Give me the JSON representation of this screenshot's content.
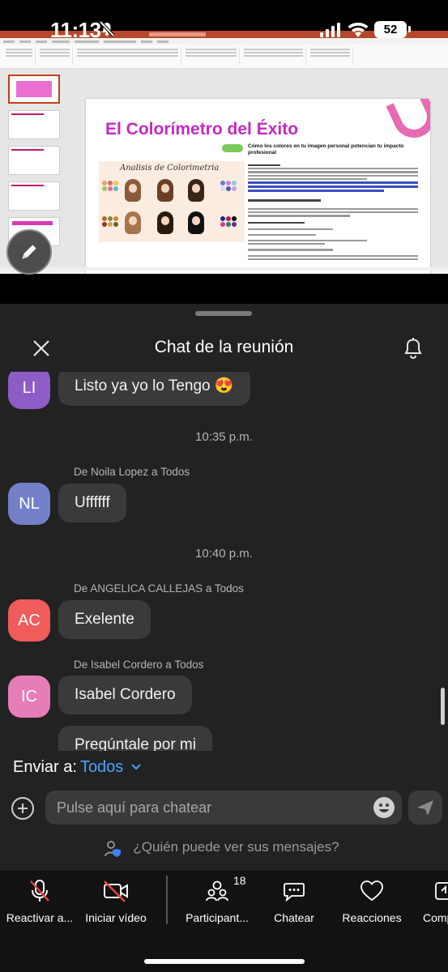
{
  "status_bar": {
    "time": "11:13",
    "battery": "52"
  },
  "shared_screen": {
    "slide_title": "El Colorímetro del Éxito",
    "slide_subtitle": "Cómo los colores en tu imagen personal potencian tu impacto profesional",
    "image_caption": "Analisis de Colorimetria"
  },
  "chat": {
    "title": "Chat de la reunión",
    "messages": [
      {
        "initials": "LI",
        "avatar_color": "#8e5cc7",
        "text": "Listo ya yo lo Tengo 😍"
      },
      {
        "time": "10:35 p.m."
      },
      {
        "sender": "De Noila Lopez a Todos",
        "initials": "NL",
        "avatar_color": "#7380c9",
        "text": "Uffffff"
      },
      {
        "time": "10:40 p.m."
      },
      {
        "sender": "De ANGELICA CALLEJAS a Todos",
        "initials": "AC",
        "avatar_color": "#f05b5b",
        "text": "Exelente"
      },
      {
        "sender": "De Isabel Cordero a Todos",
        "initials": "IC",
        "avatar_color": "#e77db8",
        "text": "Isabel Cordero"
      },
      {
        "text": "Pregúntale por mi"
      }
    ],
    "send_to_label": "Enviar a:",
    "send_to_value": "Todos",
    "input_placeholder": "Pulse aquí para chatear",
    "who_sees": "¿Quién puede ver sus mensajes?"
  },
  "toolbar": {
    "unmute": "Reactivar a...",
    "start_video": "Iniciar vídeo",
    "participants": "Participant...",
    "participants_count": "18",
    "chat": "Chatear",
    "reactions": "Reacciones",
    "share": "Comp"
  },
  "colors": {
    "accent_blue": "#4aa3ff",
    "panel_bg": "#222222",
    "bubble_bg": "#3a3a3c"
  }
}
